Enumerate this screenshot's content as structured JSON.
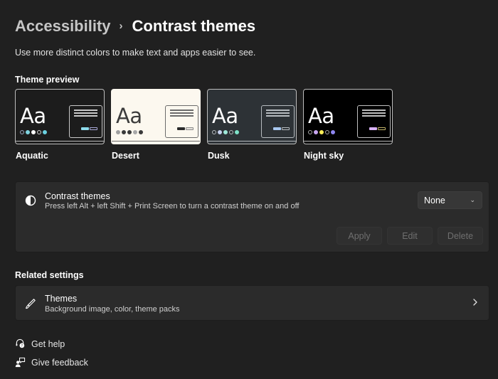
{
  "breadcrumb": {
    "parent": "Accessibility",
    "separator": "›",
    "current": "Contrast themes"
  },
  "subtitle": "Use more distinct colors to make text and apps easier to see.",
  "theme_preview": {
    "title": "Theme preview",
    "themes": [
      {
        "name": "Aquatic",
        "sample_text": "Aa",
        "colors": {
          "background": "#1c1c1c",
          "text": "#ffffff",
          "border": "#bdbdbd",
          "window_border": "#c8c8c8",
          "lines": "#c8c8c8",
          "dots": [
            "#202020",
            "#7fd3e0",
            "#ffffff",
            "#202020",
            "#6ad0e0"
          ],
          "dot_borders": [
            "#9aa7c2",
            "#7fd3e0",
            "#ffffff",
            "#cfcfcf",
            "#6ad0e0"
          ],
          "btn1": "#8edcec",
          "btn2_border": "#a9a9d8",
          "btn2_fill": "#1c1c1c",
          "bar": "#bdbdbd"
        }
      },
      {
        "name": "Desert",
        "sample_text": "Aa",
        "colors": {
          "background": "#fcf8ef",
          "text": "#3c3c3c",
          "border": "#fcf8ef",
          "window_border": "#6b6b6b",
          "lines": "#6b6b6b",
          "dots": [
            "#9f9f9f",
            "#3a3a3a",
            "#3a3a3a",
            "#a8a8a8",
            "#3a3a3a"
          ],
          "dot_borders": [
            "#9f9f9f",
            "#3a3a3a",
            "#3a3a3a",
            "#a8a8a8",
            "#3a3a3a"
          ],
          "btn1": "#2a2a2a",
          "btn2_border": "#8a8a8a",
          "btn2_fill": "#e6e3dc",
          "bar": "#6b6b6b"
        }
      },
      {
        "name": "Dusk",
        "sample_text": "Aa",
        "colors": {
          "background": "#2d3236",
          "text": "#ffffff",
          "border": "#bdbdbd",
          "window_border": "#b7bcc0",
          "lines": "#b7bcc0",
          "dots": [
            "#2d3236",
            "#c6d1ef",
            "#9ee8d8",
            "#2d3236",
            "#7fe2c8"
          ],
          "dot_borders": [
            "#b7bcc0",
            "#c6d1ef",
            "#9ee8d8",
            "#b7bcc0",
            "#7fe2c8"
          ],
          "btn1": "#a8c8f0",
          "btn2_border": "#b7bcc0",
          "btn2_fill": "#2d3236",
          "bar": "#b7bcc0"
        }
      },
      {
        "name": "Night sky",
        "sample_text": "Aa",
        "colors": {
          "background": "#000000",
          "text": "#ffffff",
          "border": "#bdbdbd",
          "window_border": "#bfbfbf",
          "lines": "#bfbfbf",
          "dots": [
            "#000000",
            "#c7a6f0",
            "#ffee58",
            "#000000",
            "#8f86f0"
          ],
          "dot_borders": [
            "#a8a8a8",
            "#c7a6f0",
            "#ffee58",
            "#a8a8a8",
            "#8f86f0"
          ],
          "btn1": "#d8b2f6",
          "btn2_border": "#c2b46a",
          "btn2_fill": "#000000",
          "bar": "#bfbfbf"
        }
      }
    ]
  },
  "contrast_card": {
    "icon": "contrast-icon",
    "title": "Contrast themes",
    "description": "Press left Alt + left Shift + Print Screen to turn a contrast theme on and off",
    "dropdown": {
      "value": "None",
      "icon": "chevron-down-icon"
    },
    "buttons": {
      "apply": "Apply",
      "edit": "Edit",
      "delete": "Delete"
    }
  },
  "related_settings": {
    "title": "Related settings",
    "items": [
      {
        "icon": "brush-icon",
        "title": "Themes",
        "description": "Background image, color, theme packs"
      }
    ]
  },
  "links": {
    "get_help": "Get help",
    "give_feedback": "Give feedback"
  }
}
